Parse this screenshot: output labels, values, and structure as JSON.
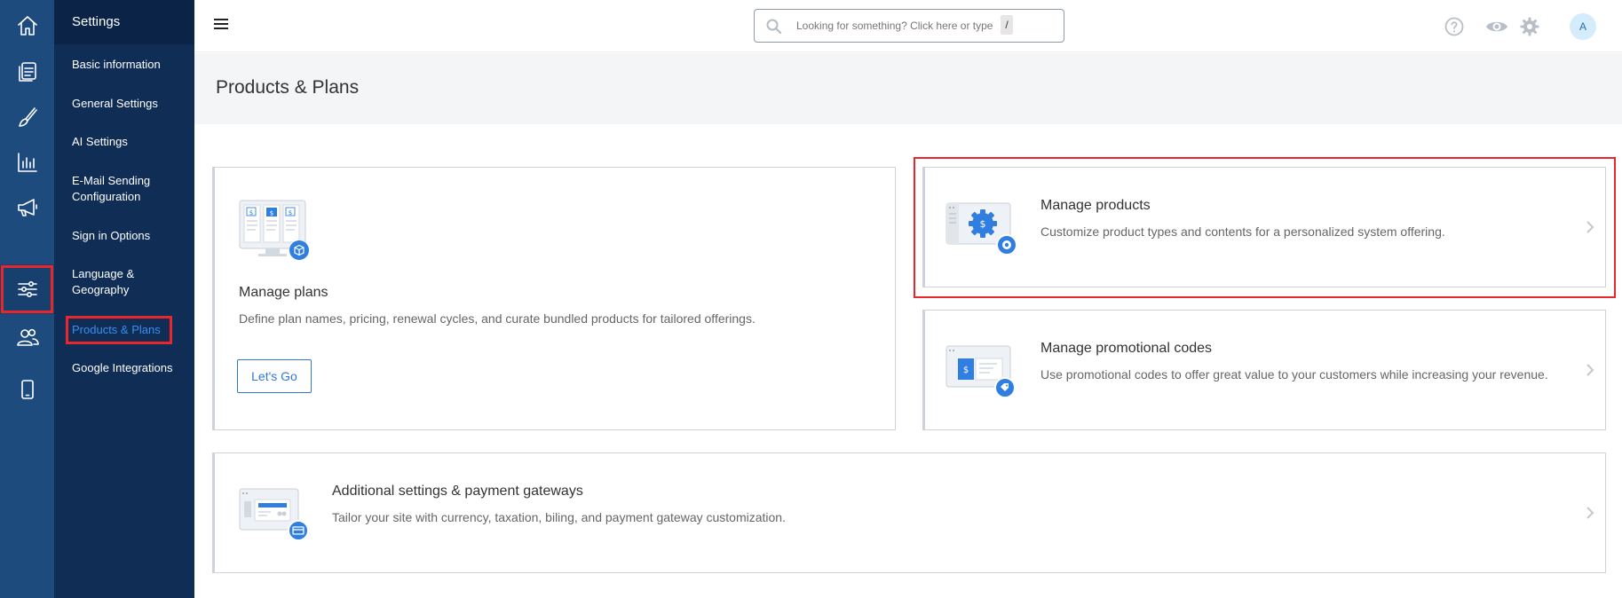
{
  "search": {
    "placeholder": "Looking for something? Click here or type",
    "shortcut": "/"
  },
  "rail": {
    "items": [
      {
        "icon": "home-icon"
      },
      {
        "icon": "pages-icon"
      },
      {
        "icon": "brush-icon"
      },
      {
        "icon": "analytics-icon"
      },
      {
        "icon": "megaphone-icon"
      },
      {
        "icon": "settings-sliders-icon",
        "active": true
      },
      {
        "icon": "users-icon"
      },
      {
        "icon": "mobile-icon"
      }
    ]
  },
  "nav": {
    "title": "Settings",
    "items": [
      {
        "label": "Basic information"
      },
      {
        "label": "General Settings"
      },
      {
        "label": "AI Settings"
      },
      {
        "label": "E-Mail Sending Configuration"
      },
      {
        "label": "Sign in Options"
      },
      {
        "label": "Language & Geography"
      },
      {
        "label": "Products & Plans",
        "active": true
      },
      {
        "label": "Google Integrations"
      }
    ]
  },
  "topbar": {
    "avatar_initial": "A"
  },
  "page": {
    "title": "Products & Plans"
  },
  "cards": {
    "plans": {
      "title": "Manage plans",
      "description": "Define plan names, pricing, renewal cycles, and curate bundled products for tailored offerings.",
      "button_label": "Let's Go"
    },
    "products": {
      "title": "Manage products",
      "description": "Customize product types and contents for a personalized system offering."
    },
    "promo": {
      "title": "Manage promotional codes",
      "description": "Use promotional codes to offer great value to your customers while increasing your revenue."
    },
    "additional": {
      "title": "Additional settings & payment gateways",
      "description": "Tailor your site with currency, taxation, biling, and payment gateway customization."
    }
  },
  "colors": {
    "accent": "#2f78d2",
    "rail": "#1e4b7d",
    "nav": "#0f2d55",
    "highlight": "#e8262b"
  }
}
